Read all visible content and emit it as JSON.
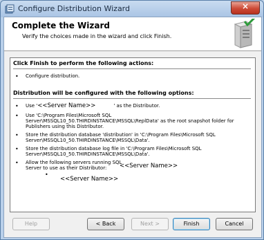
{
  "window": {
    "title": "Configure Distribution Wizard"
  },
  "header": {
    "title": "Complete the Wizard",
    "subtitle": "Verify the choices made in the wizard and click Finish."
  },
  "summary": {
    "actions_heading": "Click Finish to perform the following actions:",
    "actions": [
      "Configure distribution."
    ],
    "options_heading": "Distribution will be configured with the following options:",
    "options": {
      "use_distributor_prefix": "Use '",
      "server_name_1": "<<Server Name>>",
      "use_distributor_suffix": "' as the Distributor.",
      "snapshot_folder": "Use 'C:\\Program Files\\Microsoft SQL Server\\MSSQL10_50.THIRDINSTANCE\\MSSQL\\ReplData' as the root snapshot folder for Publishers using this Distributor.",
      "db_file": "Store the distribution database 'distribution' in 'C:\\Program Files\\Microsoft SQL Server\\MSSQL10_50.THIRDINSTANCE\\MSSQL\\Data'.",
      "log_file": "Store the distribution database log file in 'C:\\Program Files\\Microsoft SQL Server\\MSSQL10_50.THIRDINSTANCE\\MSSQL\\Data'.",
      "allow_servers": "Allow the following servers running SQL Server to use as their Distributor:",
      "server_name_2": "<<Server Name>>",
      "server_name_3": "<<Server Name>>"
    }
  },
  "buttons": {
    "help": "Help",
    "back": "< Back",
    "next": "Next >",
    "finish": "Finish",
    "cancel": "Cancel"
  },
  "colors": {
    "title_bar": "#c9dcf0",
    "close_button": "#cc4a36"
  }
}
